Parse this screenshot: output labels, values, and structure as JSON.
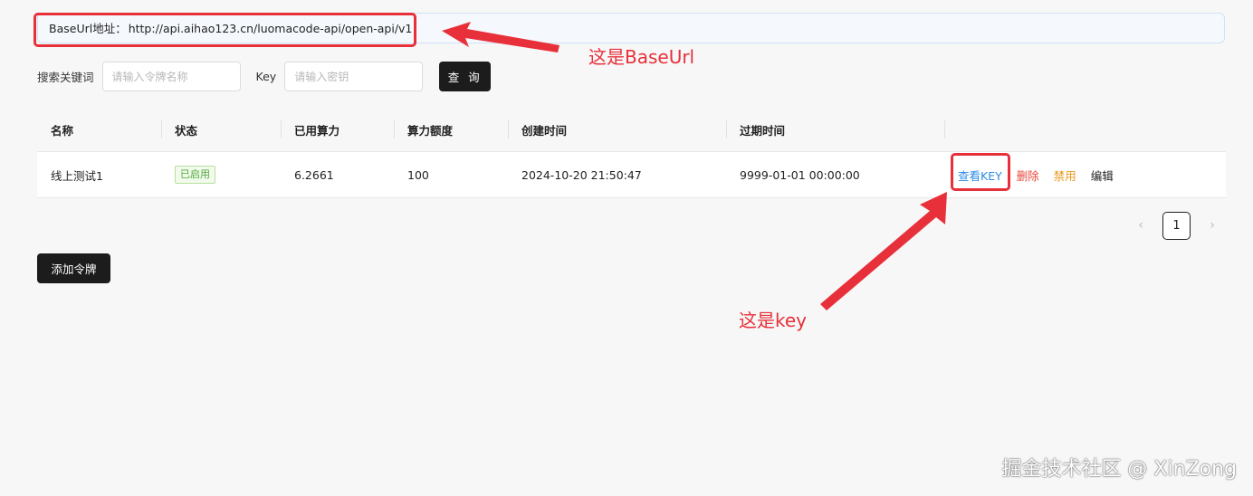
{
  "base_url": {
    "label": "BaseUrl地址：",
    "value": "http://api.aihao123.cn/luomacode-api/open-api/v1"
  },
  "search": {
    "keyword_label": "搜索关键词",
    "keyword_placeholder": "请输入令牌名称",
    "key_label": "Key",
    "key_placeholder": "请输入密钥",
    "query_button": "查 询"
  },
  "table": {
    "headers": [
      "名称",
      "状态",
      "已用算力",
      "算力额度",
      "创建时间",
      "过期时间",
      ""
    ],
    "rows": [
      {
        "name": "线上测试1",
        "status": "已启用",
        "used_power": "6.2661",
        "quota": "100",
        "created": "2024-10-20 21:50:47",
        "expires": "9999-01-01 00:00:00",
        "actions": {
          "view_key": "查看KEY",
          "delete": "删除",
          "disable": "禁用",
          "edit": "编辑"
        }
      }
    ]
  },
  "pagination": {
    "current_page": "1",
    "prev_icon": "chevron-left-icon",
    "next_icon": "chevron-right-icon"
  },
  "add_token_button": "添加令牌",
  "annotations": {
    "baseurl_note": "这是BaseUrl",
    "key_note": "这是key",
    "color": "#e8303a"
  },
  "watermark": "掘金技术社区 @ XinZong",
  "colors": {
    "primary_button": "#1c1c1c",
    "link_blue": "#2a8be6",
    "danger_red": "#e8483b",
    "warning_orange": "#e69a1e",
    "status_green": "#52a83a"
  }
}
